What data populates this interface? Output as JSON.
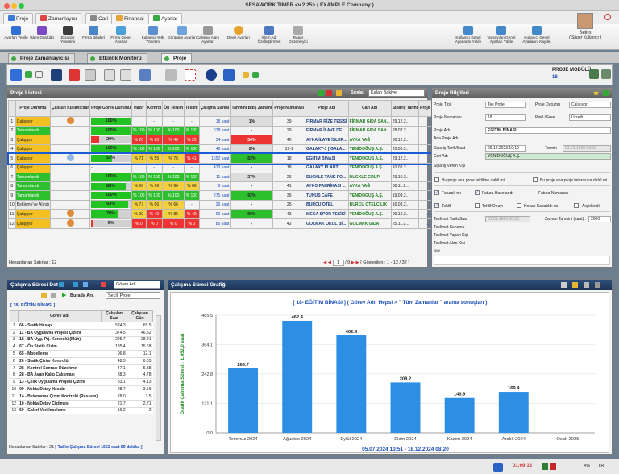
{
  "window": {
    "title": "SESAWORK TIMER <v.2.25> ( EXAMPLE Company )"
  },
  "menu": {
    "tabs": [
      "Proje",
      "Zamanlayıcı",
      "Cari",
      "Finansal",
      "Ayarlar"
    ],
    "active": "Ayarlar"
  },
  "ribbon": {
    "buttons": [
      "Ayarları Yenile",
      "İşlem Günlüğü",
      "Ekranlar Yönetimi",
      "Firma Bilgileri",
      "Firma Genel Ayarlar",
      "Kullanıcı Yetki Yönetimi",
      "Görünüm Ayarları",
      "Çalışma Alanı Ayarları",
      "Döviz Ayarları",
      "İşlem Adı Özelleştirmesi",
      "Rapor Düzenleyici",
      "Kullanıcı Genel Ayarlarını Yükle",
      "Varsayılan Genel Ayarları Yükle",
      "Kullanıcı Genel Ayarlarını Kaydet"
    ]
  },
  "user": {
    "name": "Selim",
    "role": "( Süper Kullanıcı )"
  },
  "doc_tabs": [
    "Proje Zamanlayıcısı",
    "Etkinlik Monitörü",
    "Proje"
  ],
  "module": {
    "label": "PROJE MODÜLÜ",
    "id": "18"
  },
  "project_list": {
    "title": "Proje Listesi",
    "sort_label": "Sırala:",
    "sort_value": "Kalan Bakiye",
    "columns": [
      "",
      "Proje Durumu",
      "Çalışan Kullanıcılar",
      "Proje Görev Durumu",
      "Hazır",
      "Kontrol",
      "Ön Teslim",
      "Teslim",
      "Çalışma Süresi",
      "Tahmini Bitiş Zamanı",
      "Proje Numarası",
      "Proje Adı",
      "Cari Adı",
      "Sipariş Tarihi",
      "Proje Süresi"
    ],
    "rows": [
      {
        "no": "1",
        "status": "Çalışıyor",
        "st": "work",
        "pct": "100%",
        "p": 1.0,
        "hazir": "-",
        "kontrol": "-",
        "on": "-",
        "teslim": "-",
        "sure": "18 saat",
        "bitis": "1%",
        "num": "39",
        "ad": "FİRMAR RİZE TESİSİ",
        "cari": "FİRMAR GIDA SAN...",
        "tarih": "29.12.2...",
        "psure": "... 2 ay"
      },
      {
        "no": "2",
        "status": "Tamamlandı",
        "st": "wait",
        "pct": "100%",
        "p": 1.0,
        "hazir": "% 100",
        "kontrol": "% 100",
        "on": "% 100",
        "teslim": "% 100",
        "sure": "678 saat",
        "bitis": "-",
        "num": "29",
        "ad": "FİRMAR İLAVE DE...",
        "cari": "FİRMAR GIDA SAN...",
        "tarih": "28.07.2...",
        "psure": "1 ay"
      },
      {
        "no": "3",
        "status": "Çalışıyor",
        "st": "work",
        "pct": "20%",
        "p": 0.2,
        "hazir": "% 20",
        "kontrol": "% 20",
        "on": "% 40",
        "teslim": "% 20",
        "sure": "34 saat",
        "bitis": "34%",
        "num": "40",
        "ad": "AYKA İLAVE İŞLER...",
        "cari": "AYKA YAĞ",
        "tarih": "30.12.2...",
        "psure": "... 2 ay"
      },
      {
        "no": "4",
        "status": "Çalışıyor",
        "st": "work",
        "pct": "100%",
        "p": 1.0,
        "hazir": "% 100",
        "kontrol": "% 100",
        "on": "% 100",
        "teslim": "% 100",
        "sure": "48 saat",
        "bitis": "2%",
        "num": "19-1",
        "ad": "GALAXY-1 [ GALA...",
        "cari": "YENİDOĞUŞ A.Ş.",
        "tarih": "20.03.2...",
        "psure": "10 ay"
      },
      {
        "no": "5",
        "status": "Çalışıyor",
        "st": "work",
        "pct": "52%",
        "p": 0.52,
        "hazir": "% 71",
        "kontrol": "% 55",
        "on": "% 75",
        "teslim": "% 41",
        "sure": "1652 saat",
        "bitis": "82%",
        "num": "18",
        "ad": "EĞİTİM BİNASI",
        "cari": "YENİDOĞUŞ A.Ş.",
        "tarih": "29.12.2...",
        "psure": "... 3 ay"
      },
      {
        "no": "6",
        "status": "Çalışıyor",
        "st": "work",
        "pct": "-",
        "p": 0,
        "hazir": "-",
        "kontrol": "-",
        "on": "-",
        "teslim": "-",
        "sure": "413 saat",
        "bitis": "-",
        "num": "18",
        "ad": "GALAXY PLANT",
        "cari": "YENİDOĞUŞ A.Ş.",
        "tarih": "10.02.2...",
        "psure": "... yıl 8 ..."
      },
      {
        "no": "7",
        "status": "Tamamlandı",
        "st": "wait",
        "pct": "100%",
        "p": 1.0,
        "hazir": "% 100",
        "kontrol": "% 100",
        "on": "% 100",
        "teslim": "% 100",
        "sure": "11 saat",
        "bitis": "27%",
        "num": "26",
        "ad": "DUCKLE TANK FO...",
        "cari": "DUCKLE GRUP",
        "tarih": "23.10.2...",
        "psure": "6 gün"
      },
      {
        "no": "8",
        "status": "Tamamlandı",
        "st": "wait",
        "pct": "88%",
        "p": 0.88,
        "hazir": "% 66",
        "kontrol": "% 66",
        "on": "% 66",
        "teslim": "% 66",
        "sure": "6 saat",
        "bitis": "-",
        "num": "41",
        "ad": "AYKO FABRİKASI ...",
        "cari": "AYKA YAĞ",
        "tarih": "08.11.2...",
        "psure": "29 gün"
      },
      {
        "no": "9",
        "status": "Tamamlandı",
        "st": "wait",
        "pct": "100%",
        "p": 1.0,
        "hazir": "% 100",
        "kontrol": "% 100",
        "on": "% 100",
        "teslim": "% 100",
        "sure": "275 saat",
        "bitis": "92%",
        "num": "36",
        "ad": "TUNUS CAFE",
        "cari": "YENİDOĞUŞ A.Ş.",
        "tarih": "19.09.2...",
        "psure": "... 5 ay"
      },
      {
        "no": "10",
        "status": "Bekleme'ye Alındı",
        "st": "pend",
        "pct": "93%",
        "p": 0.93,
        "hazir": "% 77",
        "kontrol": "% 66",
        "on": "% 66",
        "teslim": "-",
        "sure": "26 saat",
        "bitis": "-",
        "num": "25",
        "ad": "BURCU OTEL",
        "cari": "BURCU OTELCİLİK",
        "tarih": "16.08.2...",
        "psure": "2 ay"
      },
      {
        "no": "11",
        "status": "Çalışıyor",
        "st": "work",
        "pct": "70%",
        "p": 0.7,
        "hazir": "% 90",
        "kontrol": "% 40",
        "on": "% 85",
        "teslim": "% 40",
        "sure": "90 saat",
        "bitis": "90%",
        "num": "43",
        "ad": "MEGA SPOR TESİSİ",
        "cari": "YENİDOĞUŞ A.Ş.",
        "tarih": "09.12.2...",
        "psure": "... 23 gün"
      },
      {
        "no": "12",
        "status": "Çalışıyor",
        "st": "work",
        "pct": "6%",
        "p": 0.06,
        "hazir": "% 0",
        "kontrol": "% 0",
        "on": "% 0",
        "teslim": "% 0",
        "sure": "86 saat",
        "bitis": "-",
        "num": "42",
        "ad": "GOLMAK OKUL Bİ...",
        "cari": "GOLMAK GIDA",
        "tarih": "25.11.2...",
        "psure": "... 28 gün"
      }
    ],
    "footer_left": "Hesaplanan Satırlar : 12",
    "page": "1",
    "page_total": "/ 9",
    "footer_right": "[ Gösterilen : 1 - 12 / 32 ]"
  },
  "project_info": {
    "title": "Proje Bilgileri",
    "fields": {
      "proje_tipi_label": "Proje Tipi",
      "proje_tipi": "Tek Proje",
      "proje_durumu_label": "Proje Durumu",
      "proje_durumu": "Çalışıyor",
      "proje_no_label": "Proje Numarası",
      "proje_no": "18",
      "paid_label": "Paid / Free",
      "paid": "Ücretli",
      "proje_adi_label": "Proje Adı",
      "proje_adi": "EĞİTİM BİNASI",
      "ana_proje_label": "Ana Proje Adı",
      "siparis_label": "Sipariş Tarih/Saat",
      "siparis": "29.12.2023 10:19",
      "termin_label": "Termin",
      "termin": "01.01.1900 00:00",
      "cari_label": "Cari Adı",
      "cari": "YENİDOĞUŞ A.Ş.",
      "siparis_kisi_label": "Sipariş Veren Kişi",
      "chk1": "Bu proje ana proje teklifine dahil mi",
      "chk2": "Bu proje ana proje faturasına dahil mi",
      "fatura_label": "Faturalı mı",
      "fatura_hazir_label": "Fatura Hazırlandı",
      "fatura_no_label": "Fatura Numarası",
      "teklif_label": "Teklif",
      "teklif_onay_label": "Teklif Onayı",
      "hesap_label": "Hesap Kapatıldı mı",
      "arsiv_label": "Arşivlendi",
      "teslimat_label": "Teslimat Tarih/Saat",
      "teslimat": "01.01.1900 00:00",
      "zaman_label": "Zaman Tahmini (saat) :",
      "zaman": "2000",
      "konum_label": "Teslimat Konumu",
      "yapan_label": "Teslimat Yapan Kişi",
      "alan_label": "Teslimat Alan Kişi",
      "not_label": "Not"
    }
  },
  "work_detail": {
    "title": "Çalışma Süresi Det",
    "filter_value": "Görev Adı",
    "search_label": "Burada Ara",
    "search_value": "Seçili Proje",
    "project": "[ 18- EĞİTİM BİNASI ]",
    "columns": [
      "",
      "Görev Adı",
      "Çalışılan Saat",
      "Çalışılan Gün"
    ],
    "rows": [
      [
        "1",
        "66 - Statik Hesap",
        "524.3",
        "65.5"
      ],
      [
        "2",
        "11 - BA Uygulama Projesi Çizimi",
        "374.5",
        "46.82"
      ],
      [
        "3",
        "18 - BA Uyg. Prj. Kontrolü (Müh)",
        "225.7",
        "28.21"
      ],
      [
        "4",
        "67 - Ön Statik Çizim",
        "135.4",
        "15.68"
      ],
      [
        "5",
        "65 - Modelleme",
        "96.8",
        "12.1"
      ],
      [
        "6",
        "20 - Statik Çizim Kontrolü",
        "48.3",
        "6.03"
      ],
      [
        "7",
        "28 - Kontrol Sonrası Düzeltme",
        "47.1",
        "5.88"
      ],
      [
        "8",
        "28 - BA Avan Kalıp Çalışması",
        "38.3",
        "4.78"
      ],
      [
        "9",
        "13 - Çelik Uygulama Projesi Çizimi",
        "33.1",
        "4.13"
      ],
      [
        "10",
        "09 - Nokta Detay Hesabı",
        "28.7",
        "3.59"
      ],
      [
        "11",
        "14 - Betonarme Çizim Kontrolü (Ressam)",
        "28.0",
        "3.5"
      ],
      [
        "12",
        "10 - Nokta Detay Çizilmesi",
        "21.7",
        "2.71"
      ],
      [
        "13",
        "60 - Galeri Veri İnceleme",
        "16.2",
        "2"
      ]
    ],
    "footer_prefix": "Hesaplanan Satırlar : 21",
    "footer_total": "[ Tablo Çalışma Süresi 1652 saat 59 dakika ]"
  },
  "chart_panel": {
    "title": "Çalışma Süresi Grafiği"
  },
  "chart_data": {
    "type": "bar",
    "title": "[ 18- EĞİTİM BİNASI ] ( Görev Adı: Hepsi > \" Tüm Zamanlar \" arama sonuçları )",
    "ylabel": "Grafik Çalışma Süresi : 1.652,0 saat",
    "xlabel": "05.07.2024 10:51 - 18.12.2024 08:20",
    "categories": [
      "Temmuz 2024",
      "Ağustos 2024",
      "Eylül 2024",
      "Ekim 2024",
      "Kasım 2024",
      "Aralık 2024",
      "Ocak 2025"
    ],
    "values": [
      266.7,
      462.4,
      402.4,
      208.2,
      143.9,
      169.4,
      null
    ],
    "value_labels": [
      "266.7",
      "462.4",
      "402.4",
      "208.2",
      "143.9",
      "169.4",
      ""
    ],
    "yticks": [
      "0.0",
      "121.1",
      "242.8",
      "364.1",
      "485.5"
    ],
    "ylim": [
      0,
      485.5
    ],
    "bar_color": "#2d8fe3"
  },
  "status": {
    "time": "01:09:13",
    "zoom": "4%",
    "tr": "TR"
  }
}
